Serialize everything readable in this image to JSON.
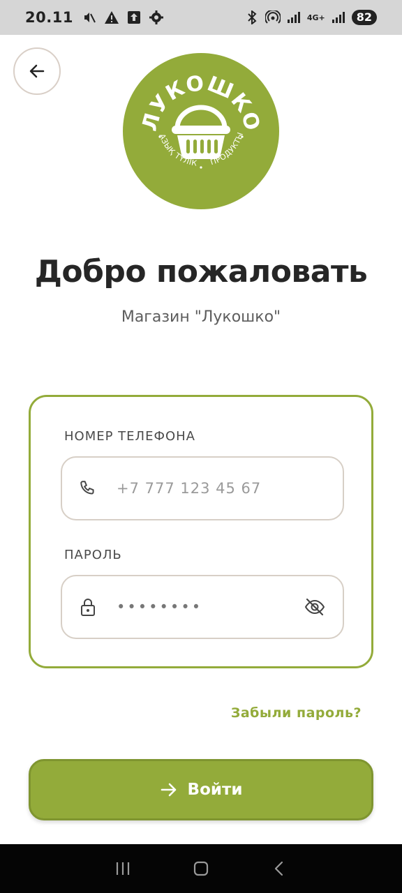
{
  "status_bar": {
    "time": "20.11",
    "network": "4G+",
    "battery": "82"
  },
  "logo": {
    "brand": "ЛУКОШКО",
    "tagline_left": "АЗЫҚ ТҮЛІК",
    "tagline_right": "ПРОДУКТЫ",
    "color": "#93ab3a"
  },
  "welcome": {
    "title": "Добро пожаловать",
    "subtitle": "Магазин \"Лукошко\""
  },
  "form": {
    "phone": {
      "label": "НОМЕР ТЕЛЕФОНА",
      "placeholder": "+7 777 123 45 67",
      "icon": "phone-icon"
    },
    "password": {
      "label": "ПАРОЛЬ",
      "value": "••••••••",
      "icon": "lock-icon",
      "toggle_icon": "eye-off-icon"
    }
  },
  "forgot_password": "Забыли пароль?",
  "login_button": {
    "label": "Войти",
    "icon": "arrow-right-icon"
  },
  "colors": {
    "accent": "#93ab3a",
    "border": "#d7cfc6"
  }
}
